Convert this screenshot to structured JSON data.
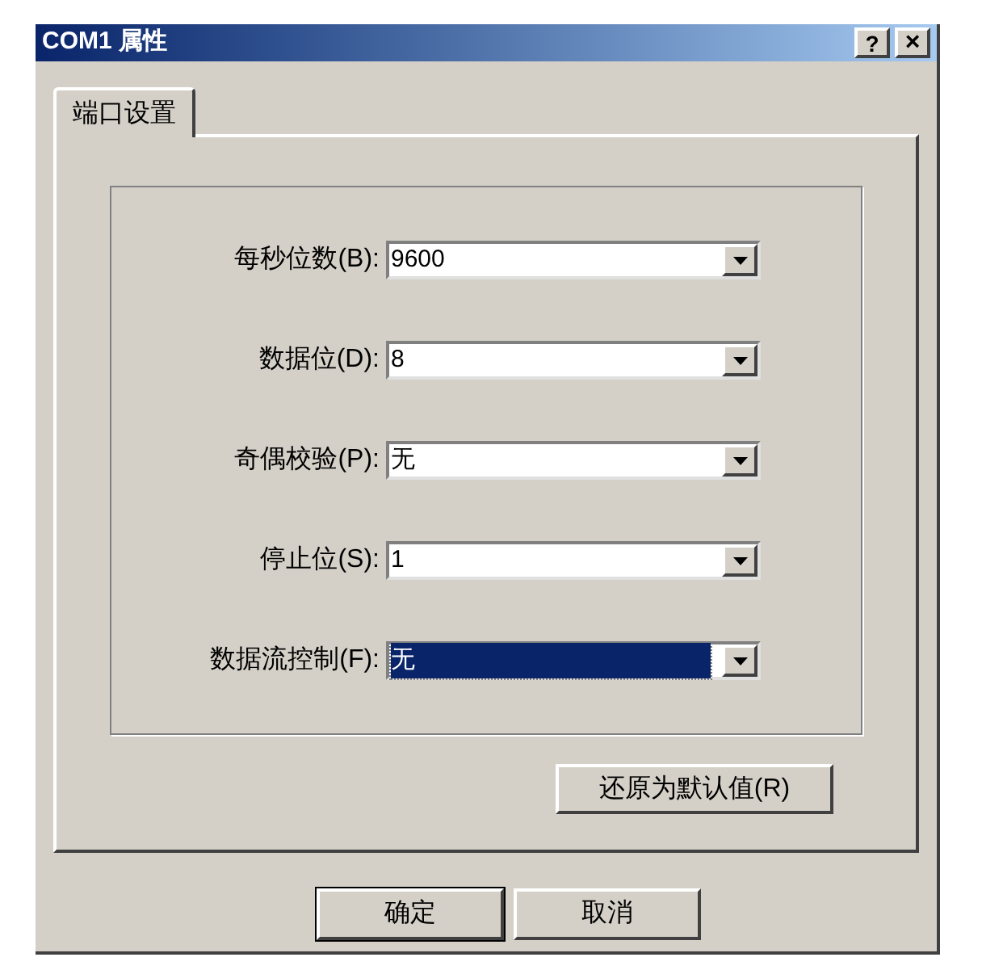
{
  "window": {
    "title": "COM1 属性",
    "help_button": "?",
    "close_button": "×"
  },
  "tabs": [
    {
      "label": "端口设置",
      "selected": true
    }
  ],
  "fields": [
    {
      "label": "每秒位数(B):",
      "value": "9600",
      "focused": false
    },
    {
      "label": "数据位(D):",
      "value": "8",
      "focused": false
    },
    {
      "label": "奇偶校验(P):",
      "value": "无",
      "focused": false
    },
    {
      "label": "停止位(S):",
      "value": "1",
      "focused": false
    },
    {
      "label": "数据流控制(F):",
      "value": "无",
      "focused": true
    }
  ],
  "restore_button": "还原为默认值(R)",
  "buttons": [
    {
      "label": "确定",
      "default": true
    },
    {
      "label": "取消",
      "default": false
    }
  ]
}
